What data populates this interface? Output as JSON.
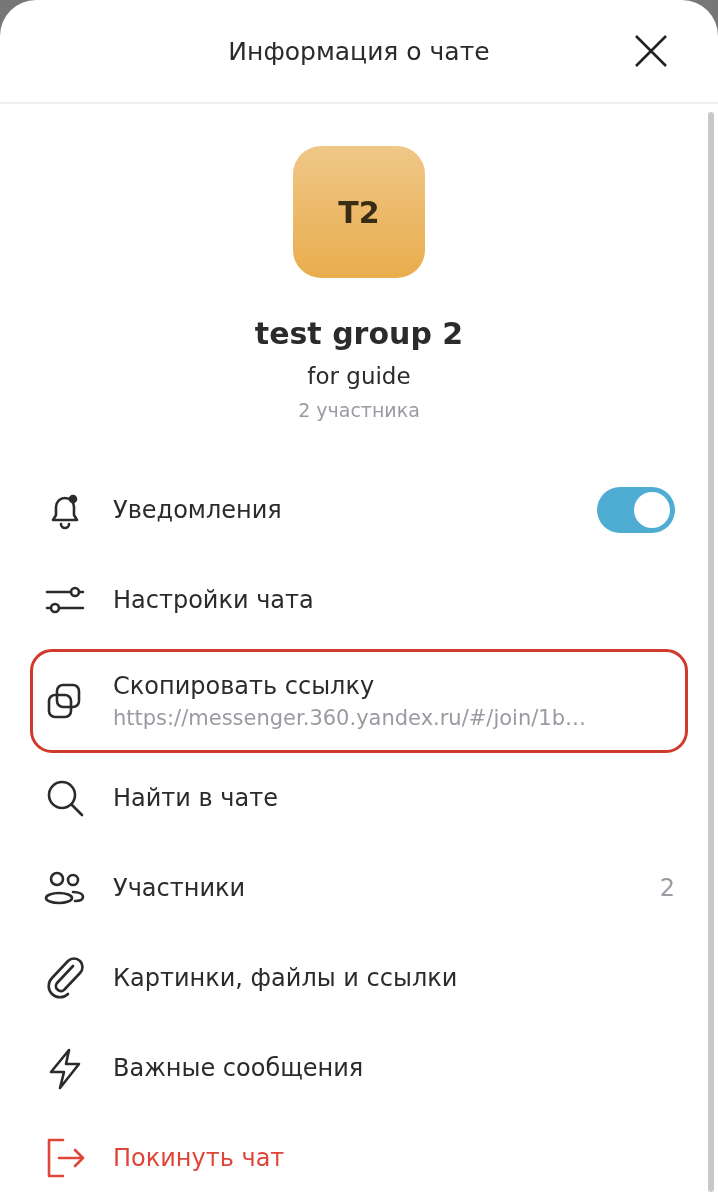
{
  "header": {
    "title": "Информация о чате"
  },
  "chat": {
    "avatar_text": "T2",
    "name": "test group 2",
    "description": "for guide",
    "members": "2 участника"
  },
  "menu": [
    {
      "kind": "toggle",
      "label": "Уведомления",
      "on": true,
      "highlighted": false
    },
    {
      "kind": "plain",
      "label": "Настройки чата",
      "highlighted": false
    },
    {
      "kind": "link",
      "label": "Скопировать ссылку",
      "url": "https://messenger.360.yandex.ru/#/join/1b…",
      "highlighted": true
    },
    {
      "kind": "plain",
      "label": "Найти в чате",
      "highlighted": false
    },
    {
      "kind": "count",
      "label": "Участники",
      "count": "2",
      "highlighted": false
    },
    {
      "kind": "plain",
      "label": "Картинки, файлы и ссылки",
      "highlighted": false
    },
    {
      "kind": "plain",
      "label": "Важные сообщения",
      "highlighted": false
    },
    {
      "kind": "danger",
      "label": "Покинуть чат",
      "highlighted": false
    }
  ]
}
